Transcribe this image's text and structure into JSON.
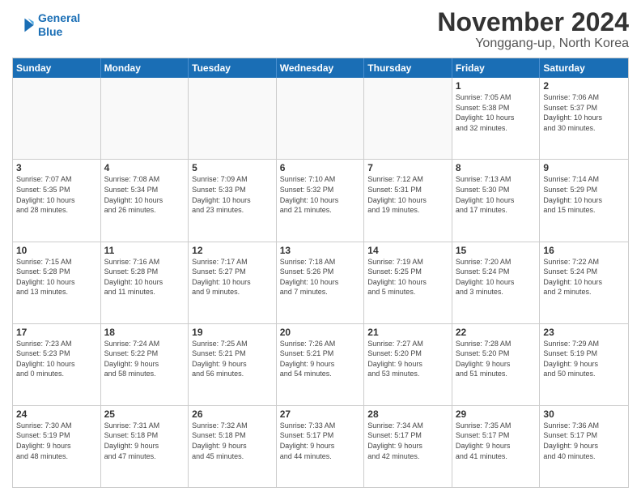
{
  "logo": {
    "line1": "General",
    "line2": "Blue"
  },
  "title": "November 2024",
  "subtitle": "Yonggang-up, North Korea",
  "header_days": [
    "Sunday",
    "Monday",
    "Tuesday",
    "Wednesday",
    "Thursday",
    "Friday",
    "Saturday"
  ],
  "weeks": [
    [
      {
        "day": "",
        "info": "",
        "shaded": true
      },
      {
        "day": "",
        "info": "",
        "shaded": true
      },
      {
        "day": "",
        "info": "",
        "shaded": true
      },
      {
        "day": "",
        "info": "",
        "shaded": true
      },
      {
        "day": "",
        "info": "",
        "shaded": true
      },
      {
        "day": "1",
        "info": "Sunrise: 7:05 AM\nSunset: 5:38 PM\nDaylight: 10 hours\nand 32 minutes."
      },
      {
        "day": "2",
        "info": "Sunrise: 7:06 AM\nSunset: 5:37 PM\nDaylight: 10 hours\nand 30 minutes."
      }
    ],
    [
      {
        "day": "3",
        "info": "Sunrise: 7:07 AM\nSunset: 5:35 PM\nDaylight: 10 hours\nand 28 minutes."
      },
      {
        "day": "4",
        "info": "Sunrise: 7:08 AM\nSunset: 5:34 PM\nDaylight: 10 hours\nand 26 minutes."
      },
      {
        "day": "5",
        "info": "Sunrise: 7:09 AM\nSunset: 5:33 PM\nDaylight: 10 hours\nand 23 minutes."
      },
      {
        "day": "6",
        "info": "Sunrise: 7:10 AM\nSunset: 5:32 PM\nDaylight: 10 hours\nand 21 minutes."
      },
      {
        "day": "7",
        "info": "Sunrise: 7:12 AM\nSunset: 5:31 PM\nDaylight: 10 hours\nand 19 minutes."
      },
      {
        "day": "8",
        "info": "Sunrise: 7:13 AM\nSunset: 5:30 PM\nDaylight: 10 hours\nand 17 minutes."
      },
      {
        "day": "9",
        "info": "Sunrise: 7:14 AM\nSunset: 5:29 PM\nDaylight: 10 hours\nand 15 minutes."
      }
    ],
    [
      {
        "day": "10",
        "info": "Sunrise: 7:15 AM\nSunset: 5:28 PM\nDaylight: 10 hours\nand 13 minutes."
      },
      {
        "day": "11",
        "info": "Sunrise: 7:16 AM\nSunset: 5:28 PM\nDaylight: 10 hours\nand 11 minutes."
      },
      {
        "day": "12",
        "info": "Sunrise: 7:17 AM\nSunset: 5:27 PM\nDaylight: 10 hours\nand 9 minutes."
      },
      {
        "day": "13",
        "info": "Sunrise: 7:18 AM\nSunset: 5:26 PM\nDaylight: 10 hours\nand 7 minutes."
      },
      {
        "day": "14",
        "info": "Sunrise: 7:19 AM\nSunset: 5:25 PM\nDaylight: 10 hours\nand 5 minutes."
      },
      {
        "day": "15",
        "info": "Sunrise: 7:20 AM\nSunset: 5:24 PM\nDaylight: 10 hours\nand 3 minutes."
      },
      {
        "day": "16",
        "info": "Sunrise: 7:22 AM\nSunset: 5:24 PM\nDaylight: 10 hours\nand 2 minutes."
      }
    ],
    [
      {
        "day": "17",
        "info": "Sunrise: 7:23 AM\nSunset: 5:23 PM\nDaylight: 10 hours\nand 0 minutes."
      },
      {
        "day": "18",
        "info": "Sunrise: 7:24 AM\nSunset: 5:22 PM\nDaylight: 9 hours\nand 58 minutes."
      },
      {
        "day": "19",
        "info": "Sunrise: 7:25 AM\nSunset: 5:21 PM\nDaylight: 9 hours\nand 56 minutes."
      },
      {
        "day": "20",
        "info": "Sunrise: 7:26 AM\nSunset: 5:21 PM\nDaylight: 9 hours\nand 54 minutes."
      },
      {
        "day": "21",
        "info": "Sunrise: 7:27 AM\nSunset: 5:20 PM\nDaylight: 9 hours\nand 53 minutes."
      },
      {
        "day": "22",
        "info": "Sunrise: 7:28 AM\nSunset: 5:20 PM\nDaylight: 9 hours\nand 51 minutes."
      },
      {
        "day": "23",
        "info": "Sunrise: 7:29 AM\nSunset: 5:19 PM\nDaylight: 9 hours\nand 50 minutes."
      }
    ],
    [
      {
        "day": "24",
        "info": "Sunrise: 7:30 AM\nSunset: 5:19 PM\nDaylight: 9 hours\nand 48 minutes."
      },
      {
        "day": "25",
        "info": "Sunrise: 7:31 AM\nSunset: 5:18 PM\nDaylight: 9 hours\nand 47 minutes."
      },
      {
        "day": "26",
        "info": "Sunrise: 7:32 AM\nSunset: 5:18 PM\nDaylight: 9 hours\nand 45 minutes."
      },
      {
        "day": "27",
        "info": "Sunrise: 7:33 AM\nSunset: 5:17 PM\nDaylight: 9 hours\nand 44 minutes."
      },
      {
        "day": "28",
        "info": "Sunrise: 7:34 AM\nSunset: 5:17 PM\nDaylight: 9 hours\nand 42 minutes."
      },
      {
        "day": "29",
        "info": "Sunrise: 7:35 AM\nSunset: 5:17 PM\nDaylight: 9 hours\nand 41 minutes."
      },
      {
        "day": "30",
        "info": "Sunrise: 7:36 AM\nSunset: 5:17 PM\nDaylight: 9 hours\nand 40 minutes."
      }
    ]
  ]
}
